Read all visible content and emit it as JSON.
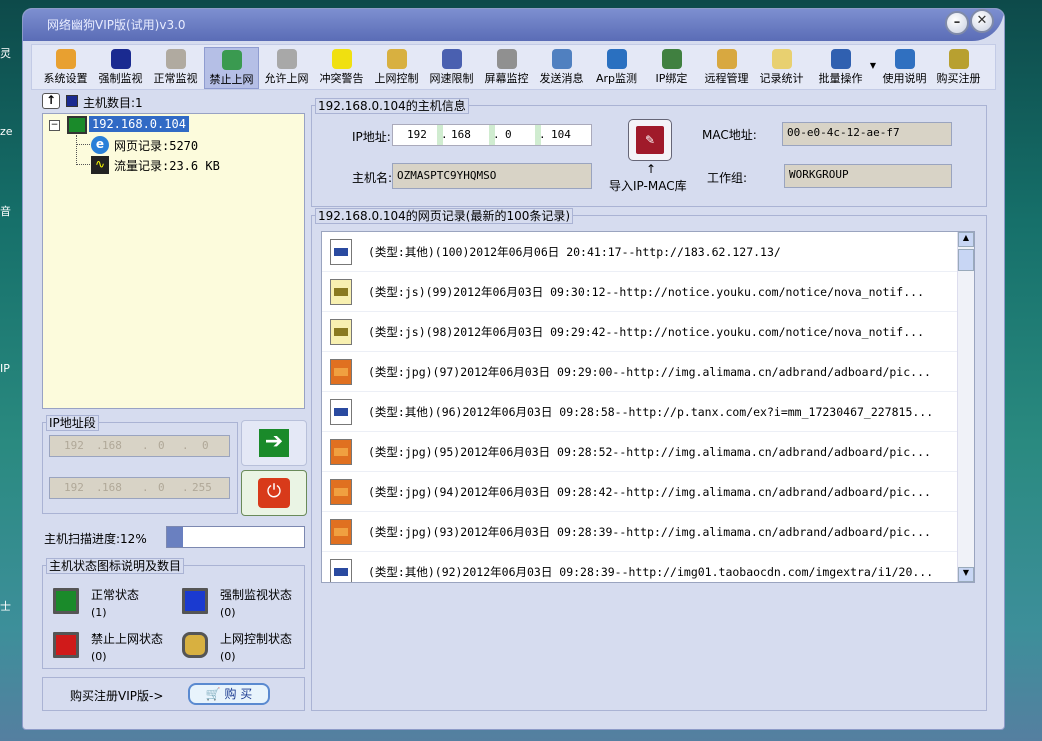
{
  "desktop": {
    "fragments": [
      "灵",
      "ze",
      "音",
      "IP",
      "士"
    ]
  },
  "window": {
    "title": "网络幽狗VIP版(试用)v3.0",
    "minimize": "–",
    "close": "✕"
  },
  "toolbar": {
    "items": [
      {
        "label": "系统设置",
        "icon": "gear-icon",
        "color": "#e8a030"
      },
      {
        "label": "强制监视",
        "icon": "monitor-icon",
        "color": "#1a2a90"
      },
      {
        "label": "正常监视",
        "icon": "blank-monitor-icon",
        "color": "#b0aaa0"
      },
      {
        "label": "禁止上网",
        "icon": "block-icon",
        "color": "#3a9a50",
        "active": true
      },
      {
        "label": "允许上网",
        "icon": "allow-icon",
        "color": "#a8a8a8"
      },
      {
        "label": "冲突警告",
        "icon": "warning-icon",
        "color": "#f0e010"
      },
      {
        "label": "上网控制",
        "icon": "lock-icon",
        "color": "#d8b040"
      },
      {
        "label": "网速限制",
        "icon": "network-icon",
        "color": "#4a60b0"
      },
      {
        "label": "屏幕监控",
        "icon": "screen-icon",
        "color": "#909090"
      },
      {
        "label": "发送消息",
        "icon": "message-icon",
        "color": "#5080c0"
      },
      {
        "label": "Arp监测",
        "icon": "globe-icon",
        "color": "#2a70c0"
      },
      {
        "label": "IP绑定",
        "icon": "bind-icon",
        "color": "#408040"
      },
      {
        "label": "远程管理",
        "icon": "remote-icon",
        "color": "#d8a840"
      },
      {
        "label": "记录统计",
        "icon": "folder-icon",
        "color": "#e8d070"
      },
      {
        "label": "批量操作",
        "icon": "batch-icon",
        "color": "#3060b0",
        "dropdown": "▼"
      },
      {
        "label": "使用说明",
        "icon": "help-icon",
        "color": "#3070c0"
      },
      {
        "label": "购买注册",
        "icon": "key-icon",
        "color": "#b8a030"
      }
    ]
  },
  "hosts": {
    "up_button": "↑",
    "count_label": "主机数目:1",
    "tree": {
      "host": "192.168.0.104",
      "collapse": "−",
      "web_records": "网页记录:5270",
      "traffic_records": "流量记录:23.6 KB"
    }
  },
  "ip_range": {
    "label": "IP地址段",
    "start": [
      "192",
      "168",
      "0",
      "0"
    ],
    "end": [
      "192",
      "168",
      "0",
      "255"
    ]
  },
  "scan": {
    "label": "主机扫描进度:12%",
    "progress": 12
  },
  "legend": {
    "label": "主机状态图标说明及数目",
    "items": [
      {
        "name": "正常状态",
        "count": "(1)",
        "color": "#1a8a2a"
      },
      {
        "name": "强制监视状态",
        "count": "(0)",
        "color": "#1a3ad0"
      },
      {
        "name": "禁止上网状态",
        "count": "(0)",
        "color": "#d01a1a"
      },
      {
        "name": "上网控制状态",
        "count": "(0)",
        "color": "#d8b040"
      }
    ]
  },
  "buy": {
    "label": "购买注册VIP版->",
    "button": "购 买"
  },
  "host_info": {
    "title": "192.168.0.104的主机信息",
    "ip_label": "IP地址:",
    "ip": [
      "192",
      "168",
      "0",
      "104"
    ],
    "mac_label": "MAC地址:",
    "mac": "00-e0-4c-12-ae-f7",
    "name_label": "主机名:",
    "name": "OZMASPTC9YHQMSO",
    "group_label": "工作组:",
    "group": "WORKGROUP",
    "import_arrow": "↑",
    "import_label": "导入IP-MAC库"
  },
  "records": {
    "title": "192.168.0.104的网页记录(最新的100条记录)",
    "items": [
      {
        "type": "other",
        "text": "(类型:其他)(100)2012年06月06日 20:41:17--http://183.62.127.13/"
      },
      {
        "type": "js",
        "text": "(类型:js)(99)2012年06月03日 09:30:12--http://notice.youku.com/notice/nova_notif..."
      },
      {
        "type": "js",
        "text": "(类型:js)(98)2012年06月03日 09:29:42--http://notice.youku.com/notice/nova_notif..."
      },
      {
        "type": "jpg",
        "text": "(类型:jpg)(97)2012年06月03日 09:29:00--http://img.alimama.cn/adbrand/adboard/pic..."
      },
      {
        "type": "other",
        "text": "(类型:其他)(96)2012年06月03日 09:28:58--http://p.tanx.com/ex?i=mm_17230467_227815..."
      },
      {
        "type": "jpg",
        "text": "(类型:jpg)(95)2012年06月03日 09:28:52--http://img.alimama.cn/adbrand/adboard/pic..."
      },
      {
        "type": "jpg",
        "text": "(类型:jpg)(94)2012年06月03日 09:28:42--http://img.alimama.cn/adbrand/adboard/pic..."
      },
      {
        "type": "jpg",
        "text": "(类型:jpg)(93)2012年06月03日 09:28:39--http://img.alimama.cn/adbrand/adboard/pic..."
      },
      {
        "type": "other",
        "text": "(类型:其他)(92)2012年06月03日 09:28:39--http://img01.taobaocdn.com/imgextra/i1/20..."
      }
    ]
  }
}
